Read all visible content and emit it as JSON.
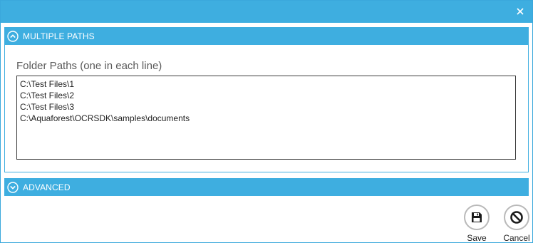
{
  "titlebar": {
    "close_icon": "close-icon"
  },
  "multiple_paths": {
    "header": "MULTIPLE PATHS",
    "toggle_icon": "chevron-up-circle-icon",
    "folder_label": "Folder Paths (one in each line)",
    "paths": [
      "C:\\Test Files\\1",
      "C:\\Test Files\\2",
      "C:\\Test Files\\3",
      "C:\\Aquaforest\\OCRSDK\\samples\\documents"
    ]
  },
  "advanced": {
    "header": "ADVANCED",
    "toggle_icon": "chevron-down-circle-icon"
  },
  "actions": {
    "save_label": "Save",
    "cancel_label": "Cancel"
  },
  "colors": {
    "accent": "#3eaee0",
    "border_dark": "#3c3c3c",
    "button_ring": "#b9b9b9"
  }
}
